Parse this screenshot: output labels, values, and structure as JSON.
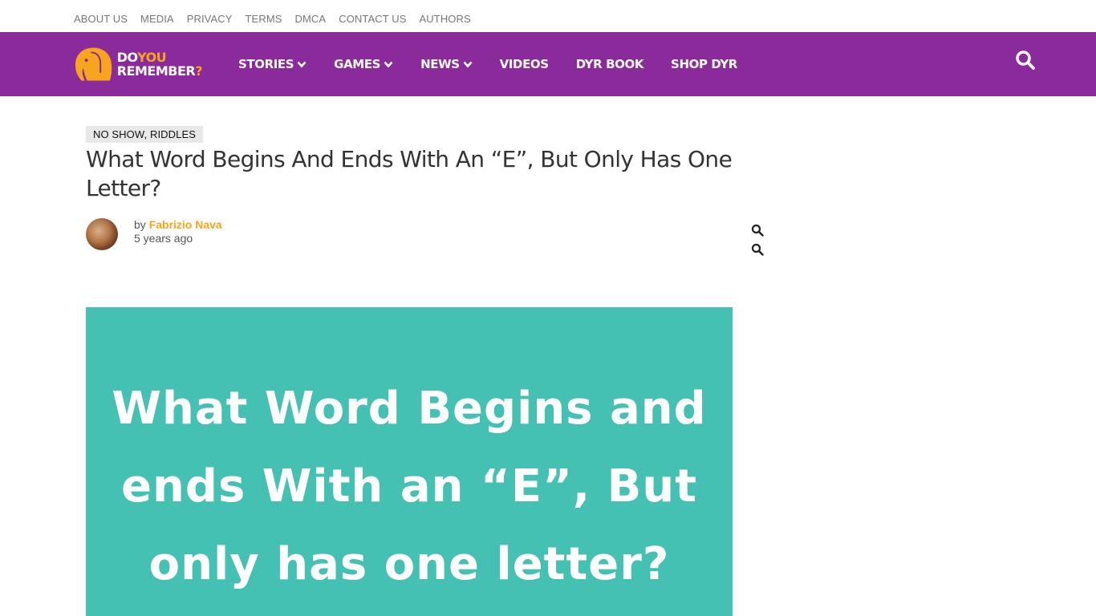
{
  "top_links": [
    "ABOUT US",
    "MEDIA",
    "PRIVACY",
    "TERMS",
    "DMCA",
    "CONTACT US",
    "AUTHORS"
  ],
  "brand": {
    "line1_a": "DO",
    "line1_b": "YOU",
    "line2_a": "REMEMBER",
    "line2_b": "?",
    "colors": {
      "nav_bg": "#8a2a9b",
      "accent": "#f7a51c"
    }
  },
  "nav": {
    "items": [
      {
        "label": "STORIES",
        "dropdown": true
      },
      {
        "label": "GAMES",
        "dropdown": true
      },
      {
        "label": "NEWS",
        "dropdown": true
      },
      {
        "label": "VIDEOS",
        "dropdown": false
      },
      {
        "label": "DYR BOOK",
        "dropdown": false
      },
      {
        "label": "SHOP DYR",
        "dropdown": false
      }
    ],
    "search_icon": "search-icon"
  },
  "article": {
    "categories": "NO SHOW, RIDDLES",
    "title": "What Word Begins And Ends With An “E”, But Only Has One Letter?",
    "byline_prefix": "by",
    "author": "Fabrizio Nava",
    "date": "5 years ago",
    "side_icons": [
      "search-icon",
      "search-icon"
    ],
    "featured_image": {
      "background": "#45c1b4",
      "lines": [
        "What Word Begins and",
        "ends With an “E”, But",
        "only has one letter?"
      ]
    }
  }
}
